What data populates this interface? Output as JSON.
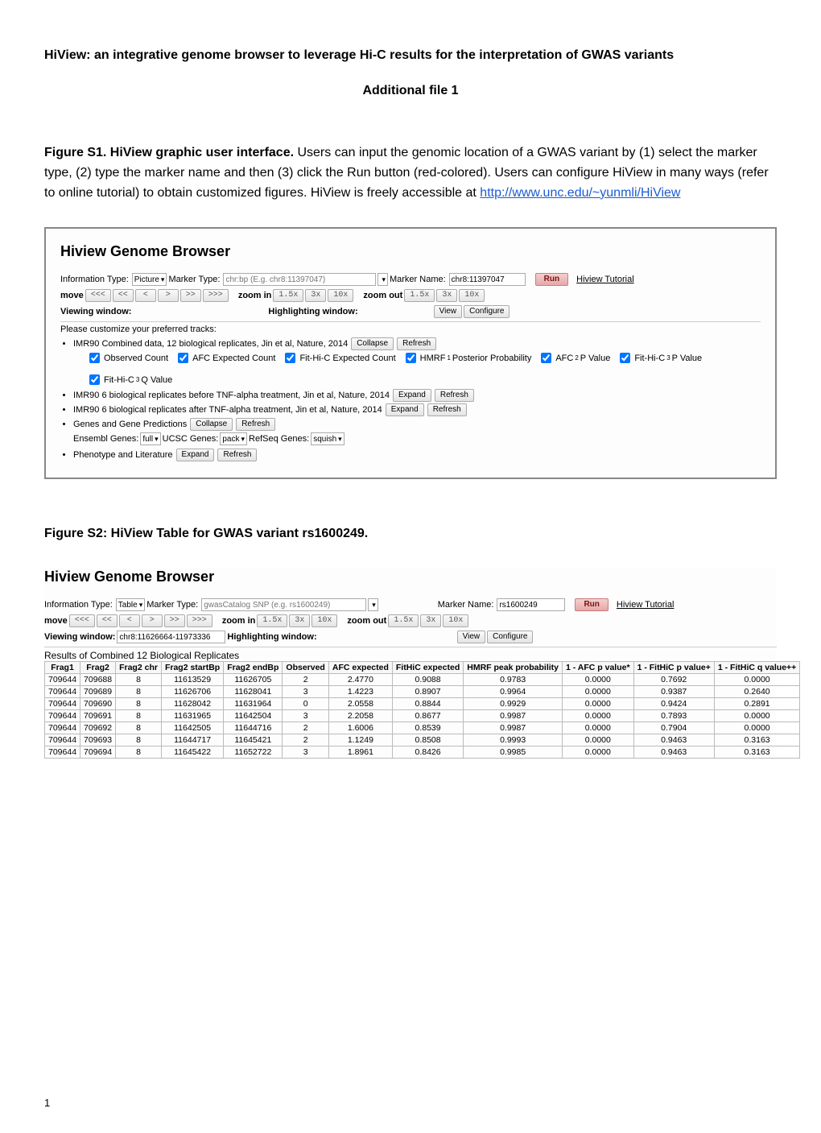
{
  "doc": {
    "title": "HiView: an integrative genome browser to leverage Hi-C results for the interpretation of GWAS variants",
    "subtitle": "Additional file 1",
    "fig1_label": "Figure S1. HiView graphic user interface.",
    "fig1_caption": " Users can input the genomic location of a GWAS variant by (1) select the marker type, (2) type the marker name and then (3) click the Run button (red-colored). Users can configure HiView in many ways (refer to online tutorial) to obtain customized figures. HiView is freely accessible at ",
    "fig1_link": "http://www.unc.edu/~yunmli/HiView",
    "fig2_label": "Figure S2: HiView Table for GWAS variant rs1600249.",
    "pagenum": "1"
  },
  "s1": {
    "panel_title": "Hiview Genome Browser",
    "info_type_lbl": "Information Type:",
    "info_type_val": "Picture",
    "marker_type_lbl": "Marker Type:",
    "marker_type_ph": "chr:bp (E.g. chr8:11397047)",
    "marker_name_lbl": "Marker Name:",
    "marker_name_val": "chr8:11397047",
    "run": "Run",
    "tutorial": "Hiview Tutorial",
    "move": "move",
    "mv": [
      "<<<",
      "<<",
      "<",
      ">",
      ">>",
      ">>>"
    ],
    "zoom_in": "zoom in",
    "zoom_out": "zoom out",
    "zoom": [
      "1.5x",
      "3x",
      "10x"
    ],
    "view_win": "Viewing window:",
    "highlight_win": "Highlighting window:",
    "view_btn": "View",
    "config_btn": "Configure",
    "tracks_header": "Please customize your preferred tracks:",
    "t1": "IMR90 Combined data, 12 biological replicates, Jin et al, Nature, 2014",
    "collapse": "Collapse",
    "expand": "Expand",
    "refresh": "Refresh",
    "checks": [
      "Observed Count",
      "AFC Expected Count",
      "Fit-Hi-C Expected Count",
      "HMRF",
      "Posterior Probability",
      "AFC",
      "P Value",
      "Fit-Hi-C",
      "P Value",
      "Fit-Hi-C",
      "Q Value"
    ],
    "chk_labels": {
      "c1": "Observed Count",
      "c2": "AFC Expected Count",
      "c3": "Fit-Hi-C Expected Count",
      "c4a": "HMRF",
      "c4b": " Posterior Probability",
      "c5a": "AFC",
      "c5b": " P Value",
      "c6a": "Fit-Hi-C",
      "c6b": " P Value",
      "c7a": "Fit-Hi-C",
      "c7b": " Q Value"
    },
    "t2": "IMR90 6 biological replicates before TNF-alpha treatment, Jin et al, Nature, 2014",
    "t3": "IMR90 6 biological replicates after TNF-alpha treatment, Jin et al, Nature, 2014",
    "t4": "Genes and Gene Predictions",
    "genes_row": {
      "ensembl_lbl": "Ensembl Genes:",
      "ensembl_val": "full",
      "ucsc_lbl": "UCSC Genes:",
      "ucsc_val": "pack",
      "refseq_lbl": "RefSeq Genes:",
      "refseq_val": "squish"
    },
    "t5": "Phenotype and Literature"
  },
  "s2": {
    "panel_title": "Hiview Genome Browser",
    "info_type_val": "Table",
    "marker_type_ph": "gwasCatalog SNP (e.g. rs1600249)",
    "marker_name_val": "rs1600249",
    "view_win_val": "chr8:11626664-11973336",
    "results_header": "Results of Combined 12 Biological Replicates",
    "cols": [
      "Frag1",
      "Frag2",
      "Frag2 chr",
      "Frag2 startBp",
      "Frag2 endBp",
      "Observed",
      "AFC expected",
      "FitHiC expected",
      "HMRF peak probability",
      "1 - AFC p value*",
      "1 - FitHiC p value+",
      "1 - FitHiC q value++"
    ],
    "rows": [
      [
        "709644",
        "709688",
        "8",
        "11613529",
        "11626705",
        "2",
        "2.4770",
        "0.9088",
        "0.9783",
        "0.0000",
        "0.7692",
        "0.0000"
      ],
      [
        "709644",
        "709689",
        "8",
        "11626706",
        "11628041",
        "3",
        "1.4223",
        "0.8907",
        "0.9964",
        "0.0000",
        "0.9387",
        "0.2640"
      ],
      [
        "709644",
        "709690",
        "8",
        "11628042",
        "11631964",
        "0",
        "2.0558",
        "0.8844",
        "0.9929",
        "0.0000",
        "0.9424",
        "0.2891"
      ],
      [
        "709644",
        "709691",
        "8",
        "11631965",
        "11642504",
        "3",
        "2.2058",
        "0.8677",
        "0.9987",
        "0.0000",
        "0.7893",
        "0.0000"
      ],
      [
        "709644",
        "709692",
        "8",
        "11642505",
        "11644716",
        "2",
        "1.6006",
        "0.8539",
        "0.9987",
        "0.0000",
        "0.7904",
        "0.0000"
      ],
      [
        "709644",
        "709693",
        "8",
        "11644717",
        "11645421",
        "2",
        "1.1249",
        "0.8508",
        "0.9993",
        "0.0000",
        "0.9463",
        "0.3163"
      ],
      [
        "709644",
        "709694",
        "8",
        "11645422",
        "11652722",
        "3",
        "1.8961",
        "0.8426",
        "0.9985",
        "0.0000",
        "0.9463",
        "0.3163"
      ]
    ]
  }
}
